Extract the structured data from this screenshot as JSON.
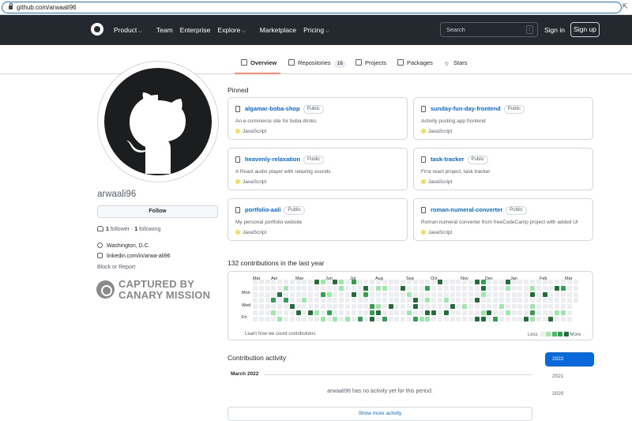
{
  "browser": {
    "url": "github.com/arwaali96"
  },
  "header": {
    "nav": [
      {
        "label": "Product",
        "dropdown": true
      },
      {
        "label": "Team",
        "dropdown": false
      },
      {
        "label": "Enterprise",
        "dropdown": false
      },
      {
        "label": "Explore",
        "dropdown": true
      },
      {
        "label": "Marketplace",
        "dropdown": false
      },
      {
        "label": "Pricing",
        "dropdown": true
      }
    ],
    "search_placeholder": "Search",
    "search_shortcut": "/",
    "signin": "Sign in",
    "signup": "Sign up"
  },
  "tabs": [
    {
      "label": "Overview",
      "icon": "book-icon",
      "active": true
    },
    {
      "label": "Repositories",
      "icon": "repo-icon",
      "count": "16"
    },
    {
      "label": "Projects",
      "icon": "project-icon"
    },
    {
      "label": "Packages",
      "icon": "package-icon"
    },
    {
      "label": "Stars",
      "icon": "star-icon"
    }
  ],
  "profile": {
    "username": "arwaali96",
    "follow": "Follow",
    "followers_count": "1",
    "followers_label": "follower",
    "separator": "·",
    "following_count": "1",
    "following_label": "following",
    "location": "Washington, D.C.",
    "linkedin": "linkedin.com/in/arwa-ali96",
    "block_report": "Block or Report",
    "stamp_line1": "CAPTURED BY",
    "stamp_line2": "CANARY MISSION"
  },
  "pinned": {
    "title": "Pinned",
    "repos": [
      {
        "name": "algamar-boba-shop",
        "visibility": "Public",
        "description": "An e-commerce site for boba drinks",
        "language": "JavaScript"
      },
      {
        "name": "sunday-fun-day-frontend",
        "visibility": "Public",
        "description": "Activity posting app frontend",
        "language": "JavaScript"
      },
      {
        "name": "heavenly-relaxation",
        "visibility": "Public",
        "description": "A React audio player with relaxing sounds",
        "language": "JavaScript"
      },
      {
        "name": "task-tracker",
        "visibility": "Public",
        "description": "First react project, task tracker",
        "language": "JavaScript"
      },
      {
        "name": "portfolio-aali",
        "visibility": "Public",
        "description": "My personal portfolio website",
        "language": "JavaScript"
      },
      {
        "name": "roman-numeral-converter",
        "visibility": "Public",
        "description": "Roman numeral converter from freeCodeCamp project with added UI",
        "language": "JavaScript"
      }
    ],
    "language_color": "#f1e05a"
  },
  "contributions": {
    "title": "132 contributions in the last year",
    "months": [
      "Mar",
      "Apr",
      "May",
      "Jun",
      "Jul",
      "Aug",
      "Sep",
      "Oct",
      "Nov",
      "Dec",
      "Jan",
      "Feb",
      "Mar"
    ],
    "days": [
      "Mon",
      "Wed",
      "Fri"
    ],
    "learn": "Learn how we count contributions",
    "less": "Less",
    "more": "More",
    "colors": [
      "#ebedf0",
      "#9be9a8",
      "#40c463",
      "#30a14e",
      "#216e39"
    ]
  },
  "activity": {
    "title": "Contribution activity",
    "month": "March 2022",
    "empty": "arwaali96 has no activity yet for this period.",
    "show_more": "Show more activity",
    "years": [
      "2022",
      "2021",
      "2020"
    ]
  }
}
